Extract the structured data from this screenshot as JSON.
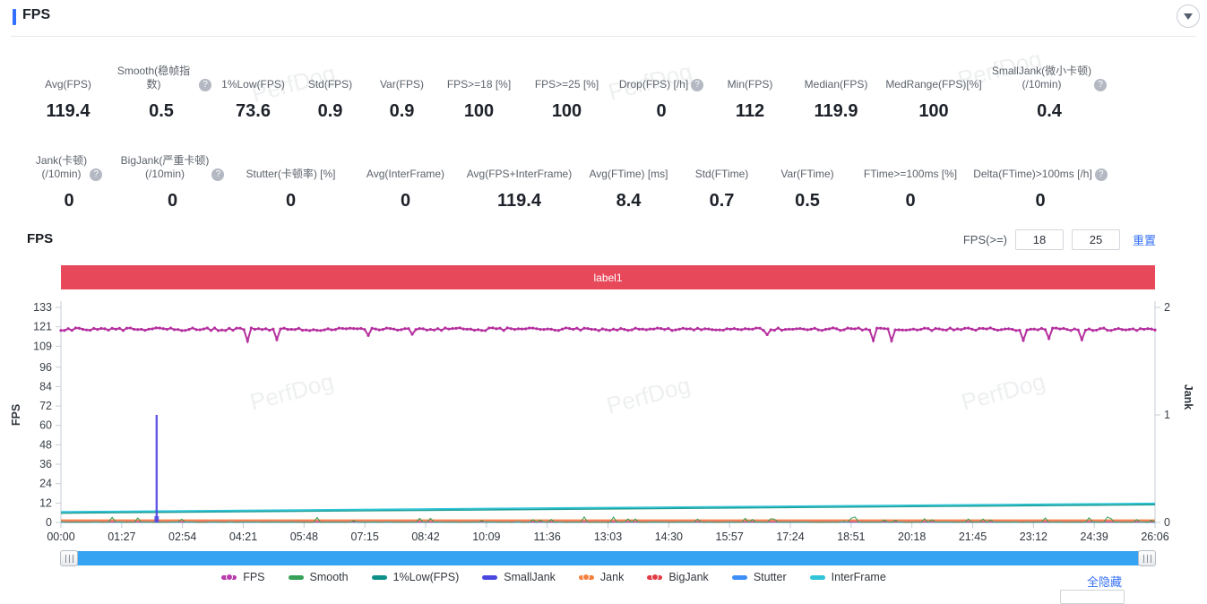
{
  "header": {
    "title": "FPS",
    "collapse_icon": "triangle-down"
  },
  "watermark_text": "PerfDog",
  "stats_row1": [
    {
      "label": "Avg(FPS)",
      "value": "119.4",
      "help": false
    },
    {
      "label": "Smooth(稳帧指数)",
      "value": "0.5",
      "help": true
    },
    {
      "label": "1%Low(FPS)",
      "value": "73.6",
      "help": false
    },
    {
      "label": "Std(FPS)",
      "value": "0.9",
      "help": false
    },
    {
      "label": "Var(FPS)",
      "value": "0.9",
      "help": false
    },
    {
      "label": "FPS>=18 [%]",
      "value": "100",
      "help": false
    },
    {
      "label": "FPS>=25 [%]",
      "value": "100",
      "help": false
    },
    {
      "label": "Drop(FPS) [/h]",
      "value": "0",
      "help": true
    },
    {
      "label": "Min(FPS)",
      "value": "112",
      "help": false
    },
    {
      "label": "Median(FPS)",
      "value": "119.9",
      "help": false
    },
    {
      "label": "MedRange(FPS)[%]",
      "value": "100",
      "help": false
    },
    {
      "label": "SmallJank(微小卡顿)\n(/10min)",
      "value": "0.4",
      "help": true
    }
  ],
  "stats_row2": [
    {
      "label": "Jank(卡顿)\n(/10min)",
      "value": "0",
      "help": true
    },
    {
      "label": "BigJank(严重卡顿)\n(/10min)",
      "value": "0",
      "help": true
    },
    {
      "label": "Stutter(卡顿率) [%]",
      "value": "0",
      "help": false
    },
    {
      "label": "Avg(InterFrame)",
      "value": "0",
      "help": false
    },
    {
      "label": "Avg(FPS+InterFrame)",
      "value": "119.4",
      "help": false
    },
    {
      "label": "Avg(FTime) [ms]",
      "value": "8.4",
      "help": false
    },
    {
      "label": "Std(FTime)",
      "value": "0.7",
      "help": false
    },
    {
      "label": "Var(FTime)",
      "value": "0.5",
      "help": false
    },
    {
      "label": "FTime>=100ms [%]",
      "value": "0",
      "help": false
    },
    {
      "label": "Delta(FTime)>100ms [/h]",
      "value": "0",
      "help": true
    }
  ],
  "section": {
    "title": "FPS"
  },
  "controls": {
    "fps_label": "FPS(>=)",
    "input1": "18",
    "input2": "25",
    "reset": "重置"
  },
  "banner": {
    "text": "label1",
    "color": "#e8495a"
  },
  "chart_data": {
    "type": "line",
    "title": "FPS over time with Jank events",
    "x_ticks": [
      "00:00",
      "01:27",
      "02:54",
      "04:21",
      "05:48",
      "07:15",
      "08:42",
      "10:09",
      "11:36",
      "13:03",
      "14:30",
      "15:57",
      "17:24",
      "18:51",
      "20:18",
      "21:45",
      "23:12",
      "24:39",
      "26:06"
    ],
    "x_tick_interval_seconds": 87,
    "x_range_seconds": [
      0,
      1566
    ],
    "grid": false,
    "legend_position": "bottom",
    "left_axis": {
      "label": "FPS",
      "range": [
        0,
        133
      ],
      "ticks": [
        0,
        12,
        24,
        36,
        48,
        60,
        72,
        84,
        96,
        109,
        121,
        133
      ]
    },
    "right_axis": {
      "label": "Jank",
      "range": [
        0,
        2
      ],
      "ticks": [
        0,
        1,
        2
      ]
    },
    "series": [
      {
        "name": "Stutter",
        "color": "#3e8ef7",
        "axis": "left",
        "style": "flat",
        "value": 0.15
      },
      {
        "name": "1%Low(FPS)",
        "color": "#1f9e94",
        "axis": "left",
        "style": "line",
        "points": [
          [
            0,
            5.8
          ],
          [
            1566,
            11.0
          ]
        ]
      },
      {
        "name": "InterFrame",
        "color": "#2fc4d8",
        "axis": "left",
        "style": "line",
        "points": [
          [
            0,
            6.6
          ],
          [
            1566,
            11.8
          ]
        ]
      },
      {
        "name": "BigJank",
        "color": "#e23b45",
        "axis": "left",
        "style": "flat",
        "value": 0.5
      },
      {
        "name": "Jank",
        "color": "#f5803e",
        "axis": "left",
        "style": "flat",
        "value": 1.5
      },
      {
        "name": "Smooth",
        "color": "#35a159",
        "axis": "left",
        "style": "bumps",
        "baseline": 0.3,
        "bump_max": 3.2,
        "bump_probability": 0.13
      },
      {
        "name": "SmallJank",
        "color": "#5046e5",
        "axis": "right",
        "style": "spike",
        "spike_at_seconds": 137,
        "spike_value": 1
      },
      {
        "name": "FPS",
        "color": "#b5309f",
        "axis": "left",
        "style": "noisy-dots",
        "baseline": 119.4,
        "noise": 1.7,
        "dip_probability": 0.05,
        "dip_range": [
          112,
          116.5
        ],
        "avg": 119.4,
        "min": 112,
        "median": 119.9
      }
    ]
  },
  "legend": {
    "items": [
      {
        "name": "FPS",
        "color": "#b93bac",
        "dot": true
      },
      {
        "name": "Smooth",
        "color": "#35a159",
        "dot": false
      },
      {
        "name": "1%Low(FPS)",
        "color": "#0e8f8a",
        "dot": false
      },
      {
        "name": "SmallJank",
        "color": "#4a46e0",
        "dot": false
      },
      {
        "name": "Jank",
        "color": "#f5803e",
        "dot": true
      },
      {
        "name": "BigJank",
        "color": "#e23b45",
        "dot": true
      },
      {
        "name": "Stutter",
        "color": "#3e8ef7",
        "dot": false
      },
      {
        "name": "InterFrame",
        "color": "#2fc4d8",
        "dot": false
      }
    ],
    "hide_all": "全隐藏"
  }
}
